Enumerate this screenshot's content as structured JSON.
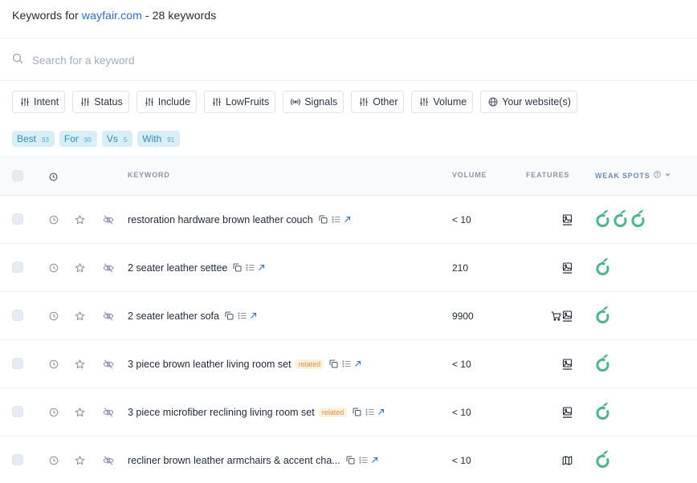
{
  "header": {
    "prefix": "Keywords for ",
    "domain": "wayfair.com",
    "suffix": " - 28 keywords"
  },
  "search": {
    "placeholder": "Search for a keyword",
    "value": ""
  },
  "filters": [
    {
      "label": "Intent",
      "icon": "sliders-icon"
    },
    {
      "label": "Status",
      "icon": "sliders-icon"
    },
    {
      "label": "Include",
      "icon": "sliders-icon"
    },
    {
      "label": "LowFruits",
      "icon": "sliders-icon"
    },
    {
      "label": "Signals",
      "icon": "broadcast-icon"
    },
    {
      "label": "Other",
      "icon": "sliders-icon"
    },
    {
      "label": "Volume",
      "icon": "sliders-icon"
    },
    {
      "label": "Your website(s)",
      "icon": "globe-icon"
    }
  ],
  "chips": [
    {
      "label": "Best",
      "count": "93"
    },
    {
      "label": "For",
      "count": "90"
    },
    {
      "label": "Vs",
      "count": "5"
    },
    {
      "label": "With",
      "count": "91"
    }
  ],
  "table": {
    "columns": {
      "keyword": "KEYWORD",
      "volume": "VOLUME",
      "features": "FEATURES",
      "weak_spots": "WEAK SPOTS"
    },
    "rows": [
      {
        "keyword": "restoration hardware brown leather couch",
        "badge": "",
        "volume": "< 10",
        "features": [
          "image-icon"
        ],
        "weak_spots": 3
      },
      {
        "keyword": "2 seater leather settee",
        "badge": "",
        "volume": "210",
        "features": [
          "image-icon"
        ],
        "weak_spots": 1
      },
      {
        "keyword": "2 seater leather sofa",
        "badge": "",
        "volume": "9900",
        "features": [
          "cart-icon",
          "image-icon"
        ],
        "weak_spots": 1
      },
      {
        "keyword": "3 piece brown leather living room set",
        "badge": "related",
        "volume": "< 10",
        "features": [
          "image-icon"
        ],
        "weak_spots": 1
      },
      {
        "keyword": "3 piece microfiber reclining living room set",
        "badge": "related",
        "volume": "< 10",
        "features": [
          "image-icon"
        ],
        "weak_spots": 1
      },
      {
        "keyword": "recliner brown leather armchairs & accent cha...",
        "badge": "",
        "volume": "< 10",
        "features": [
          "map-icon"
        ],
        "weak_spots": 1
      }
    ]
  },
  "colors": {
    "link": "#2b6fd6",
    "chip_bg": "#d7eef6",
    "chip_text": "#2f8fb8",
    "weak_spot": "#4cb88a",
    "badge_text": "#e0943a",
    "badge_bg": "#fdf0dc"
  }
}
